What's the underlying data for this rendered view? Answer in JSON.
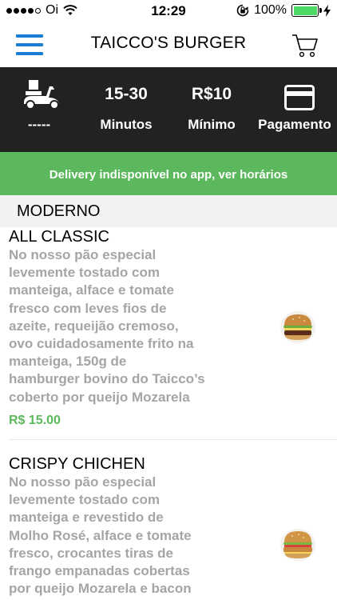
{
  "status_bar": {
    "carrier": "Oi",
    "time": "12:29",
    "battery": "100%",
    "battery_color": "#4cd964"
  },
  "header": {
    "title": "TAICCO'S BURGER",
    "menu_icon": "hamburger-menu-icon",
    "cart_icon": "shopping-cart-icon",
    "accent_color": "#1a7fd4"
  },
  "info": {
    "delivery_value": "-----",
    "time_value": "15-30",
    "time_label": "Minutos",
    "minimum_value": "R$10",
    "minimum_label": "Mínimo",
    "payment_label": "Pagamento",
    "background_color": "#222222"
  },
  "notice": {
    "text": "Delivery indisponível no app, ver horários",
    "color": "#5cb85c"
  },
  "section": {
    "title": "MODERNO"
  },
  "items": [
    {
      "name": "ALL CLASSIC",
      "description_lines": [
        "No nosso pão especial",
        "levemente tostado com",
        "manteiga, alface e tomate",
        "fresco com leves fios de",
        "azeite, requeijão cremoso,",
        "ovo cuidadosamente frito na",
        "manteiga, 150g de",
        "hamburger bovino do Taicco’s",
        "coberto por queijo Mozarela"
      ],
      "price": "R$ 15.00"
    },
    {
      "name": "CRISPY CHICHEN",
      "description_lines": [
        "No nosso pão especial",
        "levemente tostado com",
        "manteiga e revestido de",
        "Molho Rosé, alface e tomate",
        "fresco, crocantes tiras de",
        "frango empanadas cobertas",
        "por queijo Mozarela e bacon"
      ]
    }
  ]
}
